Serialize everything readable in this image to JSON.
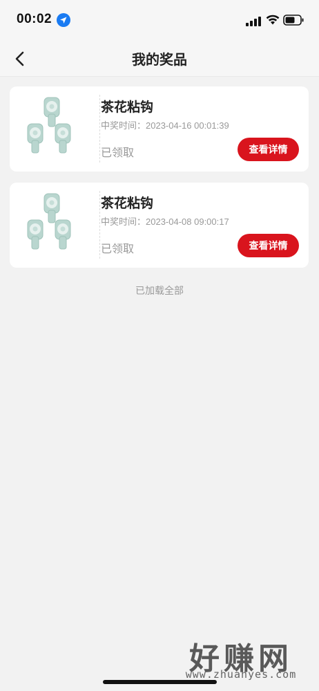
{
  "status_bar": {
    "time": "00:02"
  },
  "nav": {
    "title": "我的奖品"
  },
  "prizes": [
    {
      "name": "茶花粘钩",
      "time": "中奖时间：2023-04-16 00:01:39",
      "status": "已领取",
      "button": "查看详情"
    },
    {
      "name": "茶花粘钩",
      "time": "中奖时间：2023-04-08 09:00:17",
      "status": "已领取",
      "button": "查看详情"
    }
  ],
  "list_footer": "已加载全部",
  "watermark": {
    "title": "好赚网",
    "url": "www.zhuanyes.com"
  },
  "colors": {
    "accent": "#d9141d",
    "background": "#f2f2f2",
    "hook_green": "#b9d6cf"
  },
  "icons": [
    "location-arrow-icon",
    "signal-icon",
    "wifi-icon",
    "battery-icon",
    "back-arrow-icon",
    "camellia-hook-image"
  ]
}
